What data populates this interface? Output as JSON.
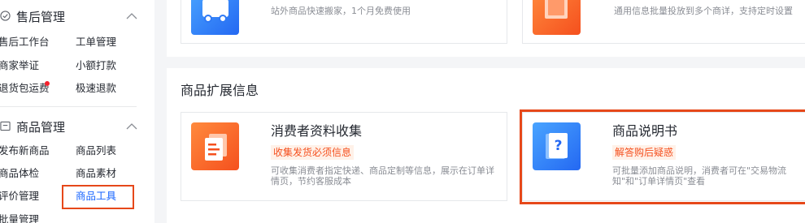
{
  "sidebar": {
    "after_sales": {
      "title": "售后管理",
      "items": [
        "售后工作台",
        "工单管理",
        "商家举证",
        "小额打款",
        "退货包运费",
        "极速退款"
      ]
    },
    "product": {
      "title": "商品管理",
      "items": [
        "发布新商品",
        "商品列表",
        "商品体检",
        "商品素材",
        "评价管理",
        "商品工具",
        "批量管理"
      ]
    }
  },
  "top_cards": [
    {
      "desc": "站外商品快速搬家，1个月免费使用"
    },
    {
      "desc": "通用信息批量投放到多个商详，支持定时设置"
    }
  ],
  "section": {
    "title": "商品扩展信息",
    "cards": [
      {
        "title": "消费者资料收集",
        "tag": "收集发货必须信息",
        "desc": "可收集消费者指定快递、商品定制等信息，展示在订单详情页，节约客服成本"
      },
      {
        "title": "商品说明书",
        "tag": "解答购后疑惑",
        "desc": "可批量添加商品说明，消费者可在\"交易物流\n知\"和\"订单详情页\"查看",
        "icon_glyph": "?"
      }
    ]
  },
  "colors": {
    "accent": "#1966ff",
    "highlight": "#e6481a",
    "tag": "#f5501e"
  }
}
